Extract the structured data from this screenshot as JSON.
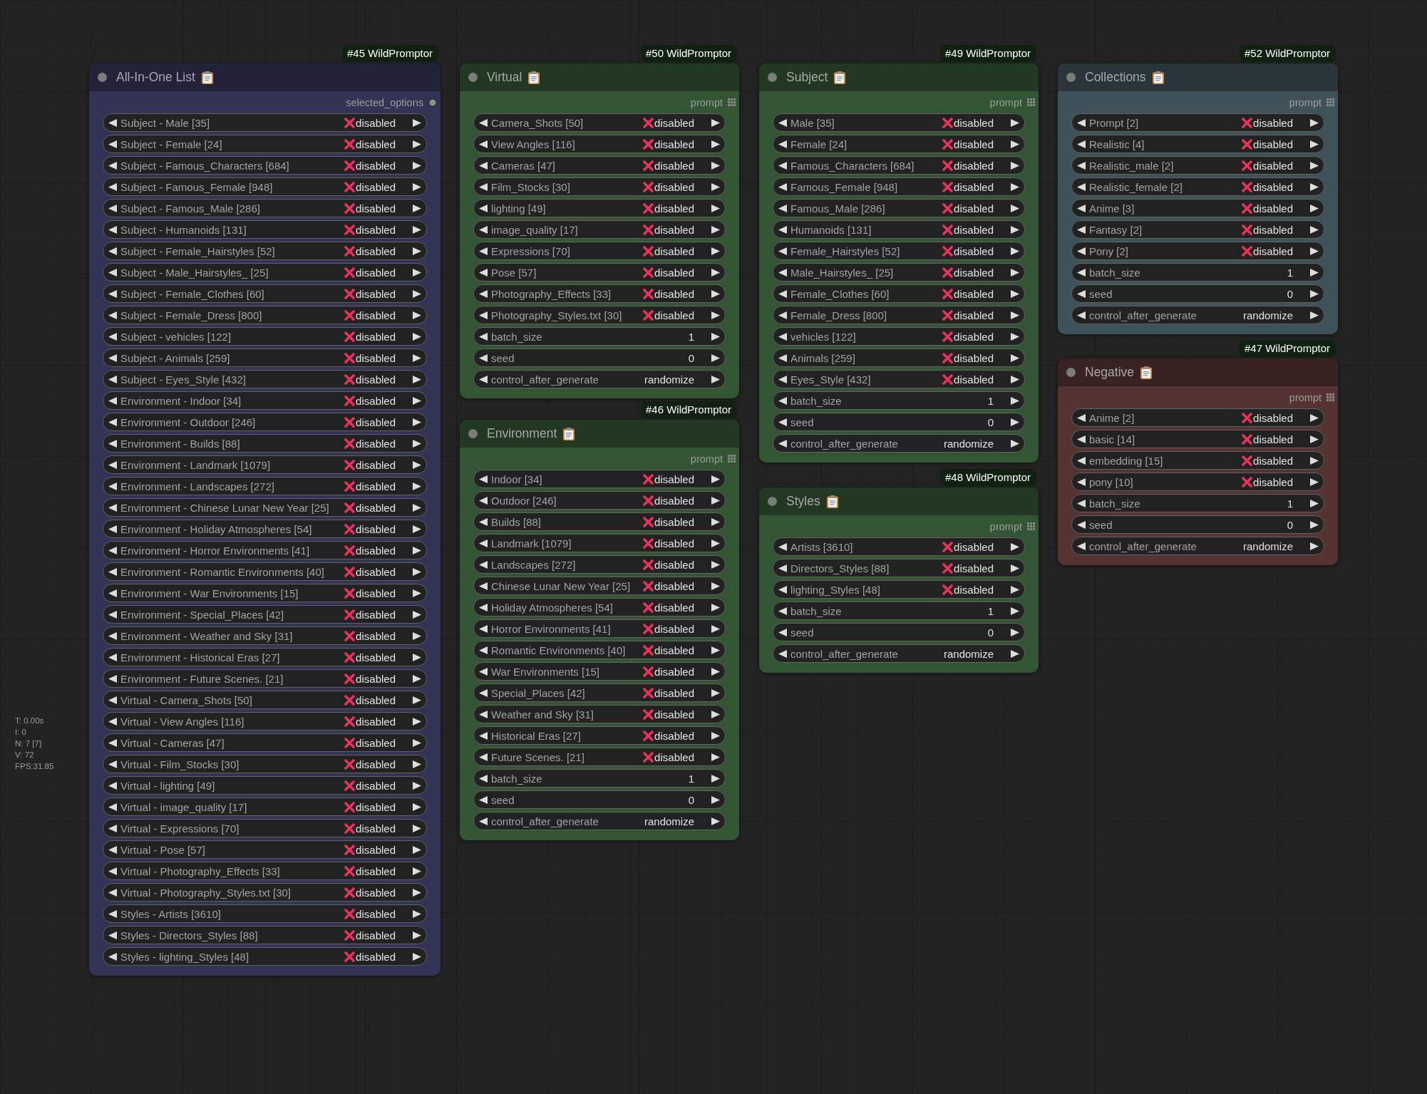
{
  "nodes": [
    {
      "badge": "#45 WildPromptor",
      "title": "All-In-One List",
      "color": "#333355",
      "output": {
        "label": "selected_options",
        "kind": "single"
      },
      "widgets": [
        {
          "kind": "toggle",
          "label": "Subject - Male [35]",
          "value": "disabled"
        },
        {
          "kind": "toggle",
          "label": "Subject - Female [24]",
          "value": "disabled"
        },
        {
          "kind": "toggle",
          "label": "Subject - Famous_Characters [684]",
          "value": "disabled"
        },
        {
          "kind": "toggle",
          "label": "Subject - Famous_Female [948]",
          "value": "disabled"
        },
        {
          "kind": "toggle",
          "label": "Subject - Famous_Male [286]",
          "value": "disabled"
        },
        {
          "kind": "toggle",
          "label": "Subject - Humanoids [131]",
          "value": "disabled"
        },
        {
          "kind": "toggle",
          "label": "Subject - Female_Hairstyles [52]",
          "value": "disabled"
        },
        {
          "kind": "toggle",
          "label": "Subject - Male_Hairstyles_ [25]",
          "value": "disabled"
        },
        {
          "kind": "toggle",
          "label": "Subject - Female_Clothes [60]",
          "value": "disabled"
        },
        {
          "kind": "toggle",
          "label": "Subject - Female_Dress [800]",
          "value": "disabled"
        },
        {
          "kind": "toggle",
          "label": "Subject - vehicles [122]",
          "value": "disabled"
        },
        {
          "kind": "toggle",
          "label": "Subject - Animals [259]",
          "value": "disabled"
        },
        {
          "kind": "toggle",
          "label": "Subject - Eyes_Style [432]",
          "value": "disabled"
        },
        {
          "kind": "toggle",
          "label": "Environment - Indoor [34]",
          "value": "disabled"
        },
        {
          "kind": "toggle",
          "label": "Environment - Outdoor [246]",
          "value": "disabled"
        },
        {
          "kind": "toggle",
          "label": "Environment - Builds [88]",
          "value": "disabled"
        },
        {
          "kind": "toggle",
          "label": "Environment - Landmark [1079]",
          "value": "disabled"
        },
        {
          "kind": "toggle",
          "label": "Environment - Landscapes [272]",
          "value": "disabled"
        },
        {
          "kind": "toggle",
          "label": "Environment - Chinese Lunar New Year [25]",
          "value": "disabled"
        },
        {
          "kind": "toggle",
          "label": "Environment - Holiday Atmospheres [54]",
          "value": "disabled"
        },
        {
          "kind": "toggle",
          "label": "Environment - Horror Environments [41]",
          "value": "disabled"
        },
        {
          "kind": "toggle",
          "label": "Environment - Romantic Environments [40]",
          "value": "disabled"
        },
        {
          "kind": "toggle",
          "label": "Environment - War Environments [15]",
          "value": "disabled"
        },
        {
          "kind": "toggle",
          "label": "Environment - Special_Places [42]",
          "value": "disabled"
        },
        {
          "kind": "toggle",
          "label": "Environment - Weather and Sky [31]",
          "value": "disabled"
        },
        {
          "kind": "toggle",
          "label": "Environment - Historical Eras [27]",
          "value": "disabled"
        },
        {
          "kind": "toggle",
          "label": "Environment - Future Scenes. [21]",
          "value": "disabled"
        },
        {
          "kind": "toggle",
          "label": "Virtual - Camera_Shots [50]",
          "value": "disabled"
        },
        {
          "kind": "toggle",
          "label": "Virtual - View Angles [116]",
          "value": "disabled"
        },
        {
          "kind": "toggle",
          "label": "Virtual - Cameras [47]",
          "value": "disabled"
        },
        {
          "kind": "toggle",
          "label": "Virtual - Film_Stocks [30]",
          "value": "disabled"
        },
        {
          "kind": "toggle",
          "label": "Virtual - lighting [49]",
          "value": "disabled"
        },
        {
          "kind": "toggle",
          "label": "Virtual - image_quality [17]",
          "value": "disabled"
        },
        {
          "kind": "toggle",
          "label": "Virtual - Expressions [70]",
          "value": "disabled"
        },
        {
          "kind": "toggle",
          "label": "Virtual - Pose [57]",
          "value": "disabled"
        },
        {
          "kind": "toggle",
          "label": "Virtual - Photography_Effects [33]",
          "value": "disabled"
        },
        {
          "kind": "toggle",
          "label": "Virtual - Photography_Styles.txt [30]",
          "value": "disabled"
        },
        {
          "kind": "toggle",
          "label": "Styles - Artists [3610]",
          "value": "disabled"
        },
        {
          "kind": "toggle",
          "label": "Styles - Directors_Styles [88]",
          "value": "disabled"
        },
        {
          "kind": "toggle",
          "label": "Styles - lighting_Styles [48]",
          "value": "disabled"
        }
      ]
    },
    {
      "badge": "#50 WildPromptor",
      "title": "Virtual",
      "color": "#335533",
      "output": {
        "label": "prompt",
        "kind": "list"
      },
      "widgets": [
        {
          "kind": "toggle",
          "label": "Camera_Shots [50]",
          "value": "disabled"
        },
        {
          "kind": "toggle",
          "label": "View Angles [116]",
          "value": "disabled"
        },
        {
          "kind": "toggle",
          "label": "Cameras [47]",
          "value": "disabled"
        },
        {
          "kind": "toggle",
          "label": "Film_Stocks [30]",
          "value": "disabled"
        },
        {
          "kind": "toggle",
          "label": "lighting [49]",
          "value": "disabled"
        },
        {
          "kind": "toggle",
          "label": "image_quality [17]",
          "value": "disabled"
        },
        {
          "kind": "toggle",
          "label": "Expressions [70]",
          "value": "disabled"
        },
        {
          "kind": "toggle",
          "label": "Pose [57]",
          "value": "disabled"
        },
        {
          "kind": "toggle",
          "label": "Photography_Effects [33]",
          "value": "disabled"
        },
        {
          "kind": "toggle",
          "label": "Photography_Styles.txt [30]",
          "value": "disabled"
        },
        {
          "kind": "number",
          "label": "batch_size",
          "value": "1"
        },
        {
          "kind": "number",
          "label": "seed",
          "value": "0"
        },
        {
          "kind": "combo",
          "label": "control_after_generate",
          "value": "randomize"
        }
      ]
    },
    {
      "badge": "#46 WildPromptor",
      "title": "Environment",
      "color": "#335533",
      "output": {
        "label": "prompt",
        "kind": "list"
      },
      "widgets": [
        {
          "kind": "toggle",
          "label": "Indoor [34]",
          "value": "disabled"
        },
        {
          "kind": "toggle",
          "label": "Outdoor [246]",
          "value": "disabled"
        },
        {
          "kind": "toggle",
          "label": "Builds [88]",
          "value": "disabled"
        },
        {
          "kind": "toggle",
          "label": "Landmark [1079]",
          "value": "disabled"
        },
        {
          "kind": "toggle",
          "label": "Landscapes [272]",
          "value": "disabled"
        },
        {
          "kind": "toggle",
          "label": "Chinese Lunar New Year [25]",
          "value": "disabled"
        },
        {
          "kind": "toggle",
          "label": "Holiday Atmospheres [54]",
          "value": "disabled"
        },
        {
          "kind": "toggle",
          "label": "Horror Environments [41]",
          "value": "disabled"
        },
        {
          "kind": "toggle",
          "label": "Romantic Environments [40]",
          "value": "disabled"
        },
        {
          "kind": "toggle",
          "label": "War Environments [15]",
          "value": "disabled"
        },
        {
          "kind": "toggle",
          "label": "Special_Places [42]",
          "value": "disabled"
        },
        {
          "kind": "toggle",
          "label": "Weather and Sky [31]",
          "value": "disabled"
        },
        {
          "kind": "toggle",
          "label": "Historical Eras [27]",
          "value": "disabled"
        },
        {
          "kind": "toggle",
          "label": "Future Scenes. [21]",
          "value": "disabled"
        },
        {
          "kind": "number",
          "label": "batch_size",
          "value": "1"
        },
        {
          "kind": "number",
          "label": "seed",
          "value": "0"
        },
        {
          "kind": "combo",
          "label": "control_after_generate",
          "value": "randomize"
        }
      ]
    },
    {
      "badge": "#49 WildPromptor",
      "title": "Subject",
      "color": "#335533",
      "output": {
        "label": "prompt",
        "kind": "list"
      },
      "widgets": [
        {
          "kind": "toggle",
          "label": "Male [35]",
          "value": "disabled"
        },
        {
          "kind": "toggle",
          "label": "Female [24]",
          "value": "disabled"
        },
        {
          "kind": "toggle",
          "label": "Famous_Characters [684]",
          "value": "disabled"
        },
        {
          "kind": "toggle",
          "label": "Famous_Female [948]",
          "value": "disabled"
        },
        {
          "kind": "toggle",
          "label": "Famous_Male [286]",
          "value": "disabled"
        },
        {
          "kind": "toggle",
          "label": "Humanoids [131]",
          "value": "disabled"
        },
        {
          "kind": "toggle",
          "label": "Female_Hairstyles [52]",
          "value": "disabled"
        },
        {
          "kind": "toggle",
          "label": "Male_Hairstyles_ [25]",
          "value": "disabled"
        },
        {
          "kind": "toggle",
          "label": "Female_Clothes [60]",
          "value": "disabled"
        },
        {
          "kind": "toggle",
          "label": "Female_Dress [800]",
          "value": "disabled"
        },
        {
          "kind": "toggle",
          "label": "vehicles [122]",
          "value": "disabled"
        },
        {
          "kind": "toggle",
          "label": "Animals [259]",
          "value": "disabled"
        },
        {
          "kind": "toggle",
          "label": "Eyes_Style [432]",
          "value": "disabled"
        },
        {
          "kind": "number",
          "label": "batch_size",
          "value": "1"
        },
        {
          "kind": "number",
          "label": "seed",
          "value": "0"
        },
        {
          "kind": "combo",
          "label": "control_after_generate",
          "value": "randomize"
        }
      ]
    },
    {
      "badge": "#48 WildPromptor",
      "title": "Styles",
      "color": "#335533",
      "output": {
        "label": "prompt",
        "kind": "list"
      },
      "widgets": [
        {
          "kind": "toggle",
          "label": "Artists [3610]",
          "value": "disabled"
        },
        {
          "kind": "toggle",
          "label": "Directors_Styles [88]",
          "value": "disabled"
        },
        {
          "kind": "toggle",
          "label": "lighting_Styles [48]",
          "value": "disabled"
        },
        {
          "kind": "number",
          "label": "batch_size",
          "value": "1"
        },
        {
          "kind": "number",
          "label": "seed",
          "value": "0"
        },
        {
          "kind": "combo",
          "label": "control_after_generate",
          "value": "randomize"
        }
      ]
    },
    {
      "badge": "#52 WildPromptor",
      "title": "Collections",
      "color": "#3f5159",
      "output": {
        "label": "prompt",
        "kind": "list"
      },
      "widgets": [
        {
          "kind": "toggle",
          "label": "Prompt [2]",
          "value": "disabled"
        },
        {
          "kind": "toggle",
          "label": "Realistic [4]",
          "value": "disabled"
        },
        {
          "kind": "toggle",
          "label": "Realistic_male [2]",
          "value": "disabled"
        },
        {
          "kind": "toggle",
          "label": "Realistic_female [2]",
          "value": "disabled"
        },
        {
          "kind": "toggle",
          "label": "Anime [3]",
          "value": "disabled"
        },
        {
          "kind": "toggle",
          "label": "Fantasy [2]",
          "value": "disabled"
        },
        {
          "kind": "toggle",
          "label": "Pony [2]",
          "value": "disabled"
        },
        {
          "kind": "number",
          "label": "batch_size",
          "value": "1"
        },
        {
          "kind": "number",
          "label": "seed",
          "value": "0"
        },
        {
          "kind": "combo",
          "label": "control_after_generate",
          "value": "randomize"
        }
      ]
    },
    {
      "badge": "#47 WildPromptor",
      "title": "Negative",
      "color": "#553333",
      "output": {
        "label": "prompt",
        "kind": "list"
      },
      "widgets": [
        {
          "kind": "toggle",
          "label": "Anime [2]",
          "value": "disabled"
        },
        {
          "kind": "toggle",
          "label": "basic [14]",
          "value": "disabled"
        },
        {
          "kind": "toggle",
          "label": "embedding [15]",
          "value": "disabled"
        },
        {
          "kind": "toggle",
          "label": "pony [10]",
          "value": "disabled"
        },
        {
          "kind": "number",
          "label": "batch_size",
          "value": "1"
        },
        {
          "kind": "number",
          "label": "seed",
          "value": "0"
        },
        {
          "kind": "combo",
          "label": "control_after_generate",
          "value": "randomize"
        }
      ]
    }
  ],
  "canvas_stats": [
    "T: 0.00s",
    "I: 0",
    "N: 7 [7]",
    "V: 72",
    "FPS:31.85"
  ]
}
